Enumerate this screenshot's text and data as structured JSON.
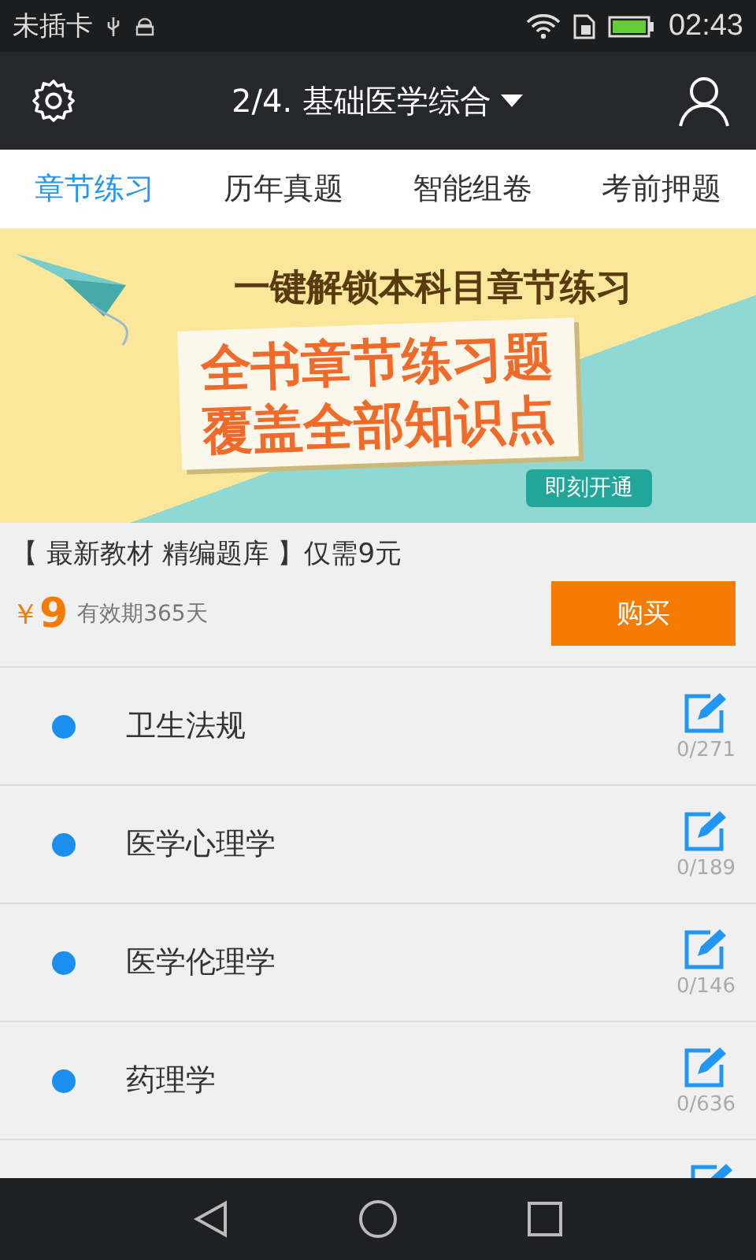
{
  "status_bar": {
    "carrier": "未插卡",
    "time": "02:43"
  },
  "app_bar": {
    "title": "2/4. 基础医学综合"
  },
  "tabs": [
    {
      "label": "章节练习",
      "selected": true
    },
    {
      "label": "历年真题",
      "selected": false
    },
    {
      "label": "智能组卷",
      "selected": false
    },
    {
      "label": "考前押题",
      "selected": false
    }
  ],
  "banner": {
    "headline": "一键解锁本科目章节练习",
    "slogan_line_1": "全书章节练习题",
    "slogan_line_2": "覆盖全部知识点",
    "cta": "即刻开通"
  },
  "offer": {
    "title": "【 最新教材 精编题库 】仅需9元",
    "currency": "￥",
    "price": "9",
    "validity": "有效期365天",
    "buy_button": "购买"
  },
  "chapters": [
    {
      "name": "卫生法规",
      "progress": "0/271"
    },
    {
      "name": "医学心理学",
      "progress": "0/189"
    },
    {
      "name": "医学伦理学",
      "progress": "0/146"
    },
    {
      "name": "药理学",
      "progress": "0/636"
    }
  ]
}
